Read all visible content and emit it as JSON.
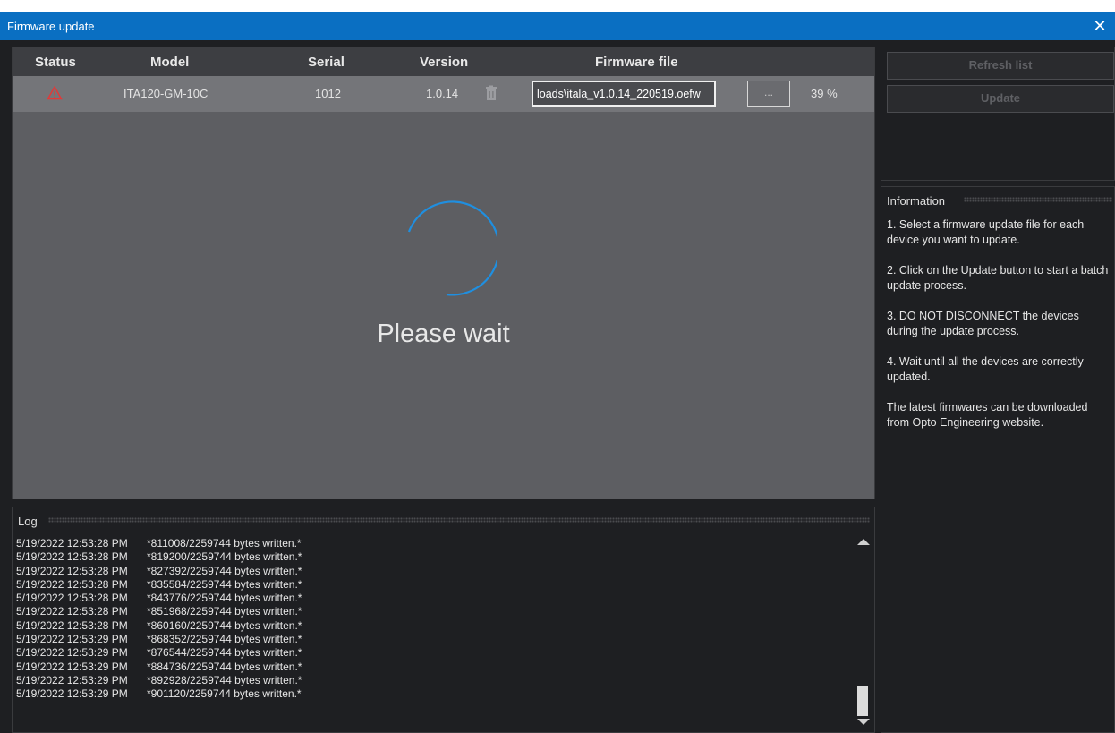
{
  "window": {
    "title": "Firmware update",
    "close_glyph": "✕"
  },
  "grid": {
    "headers": {
      "status": "Status",
      "model": "Model",
      "serial": "Serial",
      "version": "Version",
      "firmware_file": "Firmware file"
    },
    "row": {
      "status_icon": "warning-triangle-icon",
      "model": "ITA120-GM-10C",
      "serial": "1012",
      "version": "1.0.14",
      "firmware_file": "loads\\itala_v1.0.14_220519.oefw",
      "browse_label": "...",
      "progress": "39 %"
    },
    "overlay_text": "Please wait"
  },
  "log": {
    "title": "Log",
    "lines": [
      {
        "ts": "5/19/2022 12:53:28 PM",
        "msg": "*811008/2259744 bytes written.*"
      },
      {
        "ts": "5/19/2022 12:53:28 PM",
        "msg": "*819200/2259744 bytes written.*"
      },
      {
        "ts": "5/19/2022 12:53:28 PM",
        "msg": "*827392/2259744 bytes written.*"
      },
      {
        "ts": "5/19/2022 12:53:28 PM",
        "msg": "*835584/2259744 bytes written.*"
      },
      {
        "ts": "5/19/2022 12:53:28 PM",
        "msg": "*843776/2259744 bytes written.*"
      },
      {
        "ts": "5/19/2022 12:53:28 PM",
        "msg": "*851968/2259744 bytes written.*"
      },
      {
        "ts": "5/19/2022 12:53:28 PM",
        "msg": "*860160/2259744 bytes written.*"
      },
      {
        "ts": "5/19/2022 12:53:29 PM",
        "msg": "*868352/2259744 bytes written.*"
      },
      {
        "ts": "5/19/2022 12:53:29 PM",
        "msg": "*876544/2259744 bytes written.*"
      },
      {
        "ts": "5/19/2022 12:53:29 PM",
        "msg": "*884736/2259744 bytes written.*"
      },
      {
        "ts": "5/19/2022 12:53:29 PM",
        "msg": "*892928/2259744 bytes written.*"
      },
      {
        "ts": "5/19/2022 12:53:29 PM",
        "msg": "*901120/2259744 bytes written.*"
      }
    ]
  },
  "side": {
    "refresh_label": "Refresh list",
    "update_label": "Update"
  },
  "info": {
    "title": "Information",
    "paragraphs": [
      "1. Select a firmware update file for each device you want to update.",
      "2. Click on the Update button to start a batch update process.",
      "3. DO NOT DISCONNECT the devices during the update process.",
      "4. Wait until all the devices are correctly updated.",
      "The latest firmwares can be downloaded from Opto Engineering website."
    ]
  },
  "colors": {
    "titlebar": "#0a6fc2",
    "warning": "#e03a3a",
    "spinner": "#1f8fe0"
  }
}
